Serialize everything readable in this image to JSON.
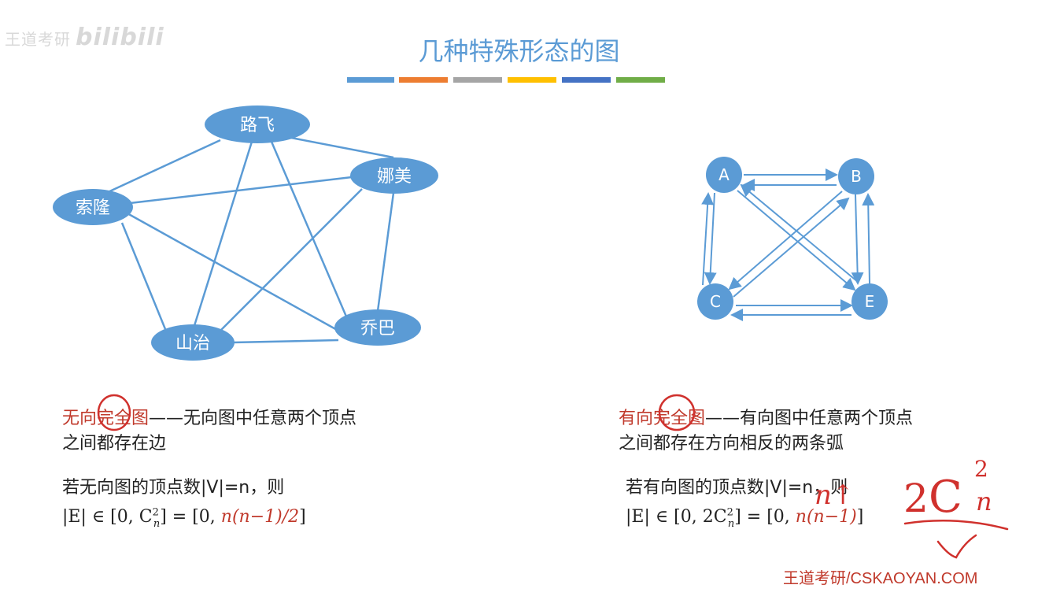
{
  "watermark": {
    "text": "王道考研",
    "bili": "bilibili"
  },
  "title": "几种特殊形态的图",
  "color_bar": [
    "#5b9bd5",
    "#ed7d31",
    "#a5a5a5",
    "#ffc000",
    "#4472c4",
    "#70ad47"
  ],
  "undirected": {
    "nodes": [
      "路飞",
      "娜美",
      "索隆",
      "山治",
      "乔巴"
    ],
    "term": "无向完全图",
    "desc1": "——无向图中任意两个顶点",
    "desc2": "之间都存在边",
    "cond": "若无向图的顶点数|V|=n，则",
    "formula_prefix": "|E| ∈ [0, C",
    "formula_sup": "2",
    "formula_sub": "n",
    "formula_mid": "] = [0, ",
    "formula_red": "n(n−1)/2",
    "formula_end": "]"
  },
  "directed": {
    "nodes": [
      "A",
      "B",
      "C",
      "E"
    ],
    "term": "有向完全图",
    "desc1": "——有向图中任意两个顶点",
    "desc2": "之间都存在方向相反的两条弧",
    "cond": "若有向图的顶点数|V|=n，则",
    "formula_prefix": "|E| ∈ [0, 2C",
    "formula_sup": "2",
    "formula_sub": "n",
    "formula_mid": "] = [0, ",
    "formula_red": "n(n−1)",
    "formula_end": "]"
  },
  "handwriting": {
    "expr_coef": "2",
    "expr_c": "C",
    "expr_sup": "2",
    "expr_sub": "n",
    "note": "n↑"
  },
  "brand": "王道考研/CSKAOYAN.COM"
}
